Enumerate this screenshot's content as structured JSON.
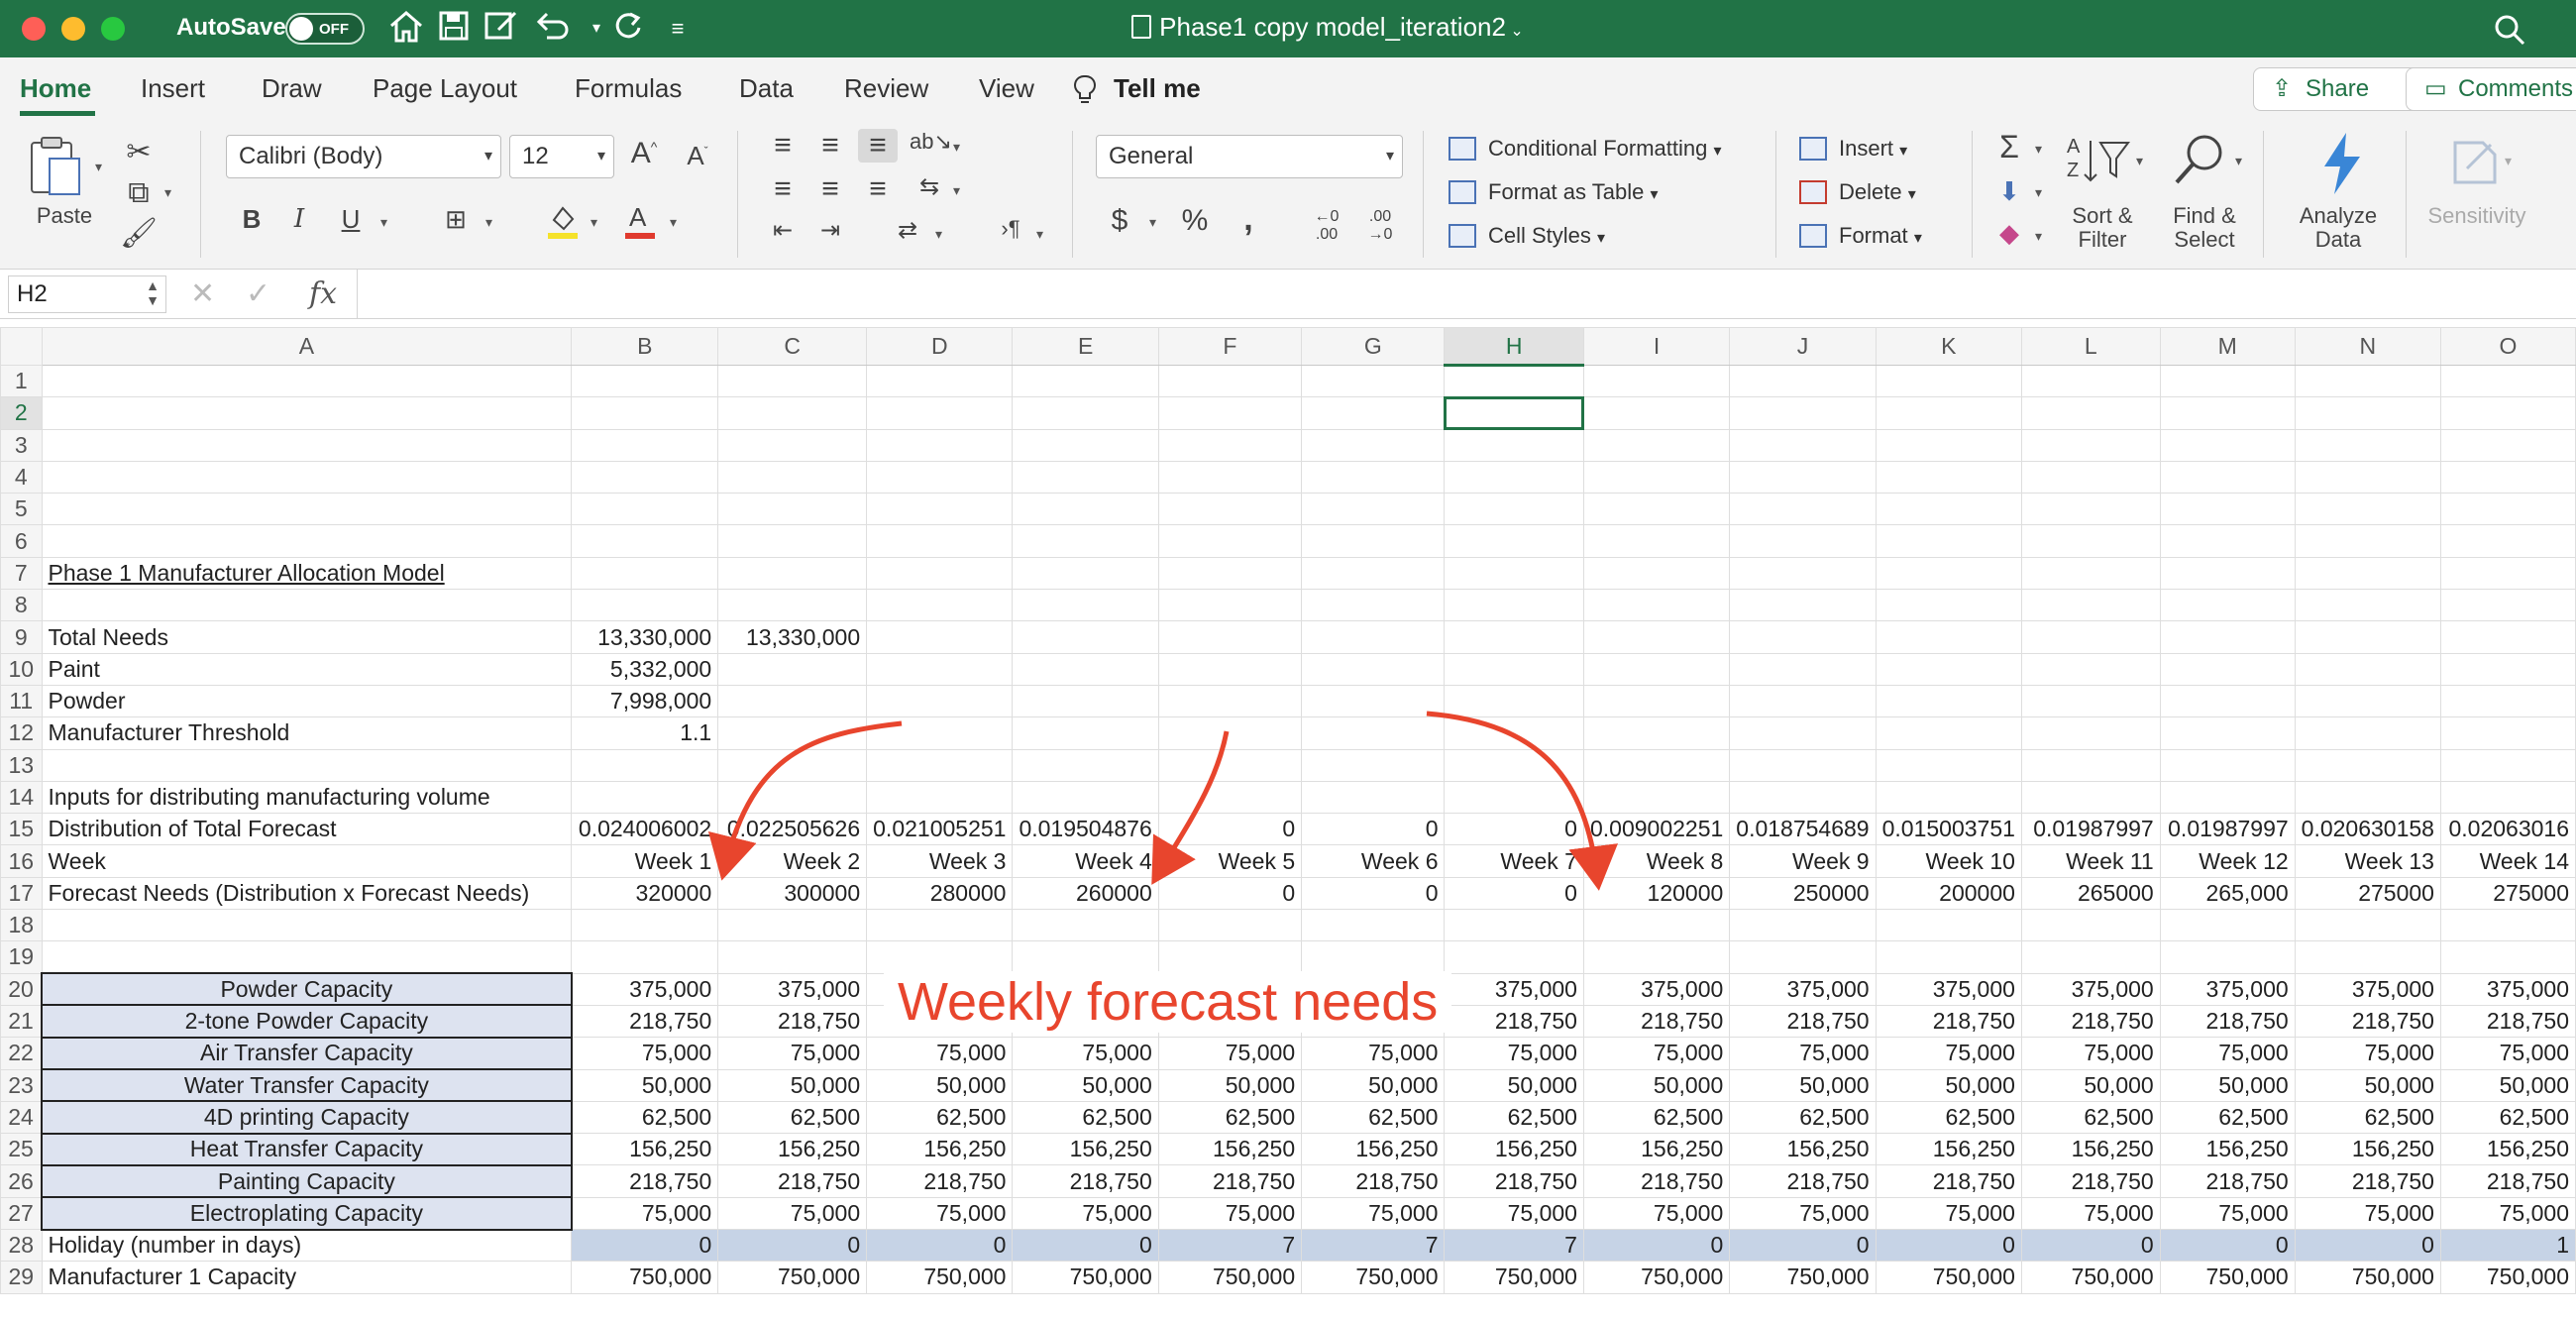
{
  "titlebar": {
    "autosave_label": "AutoSave",
    "autosave_state": "OFF",
    "document_title": "Phase1 copy model_iteration2",
    "accent": "#217346"
  },
  "tabs": [
    {
      "label": "Home"
    },
    {
      "label": "Insert"
    },
    {
      "label": "Draw"
    },
    {
      "label": "Page Layout"
    },
    {
      "label": "Formulas"
    },
    {
      "label": "Data"
    },
    {
      "label": "Review"
    },
    {
      "label": "View"
    },
    {
      "label": "Tell me"
    }
  ],
  "share_label": "Share",
  "comments_label": "Comments",
  "ribbon": {
    "paste_label": "Paste",
    "font_name": "Calibri (Body)",
    "font_size": "12",
    "bold": "B",
    "italic": "I",
    "underline": "U",
    "number_format": "General",
    "conditional_formatting": "Conditional Formatting",
    "format_as_table": "Format as Table",
    "cell_styles": "Cell Styles",
    "insert": "Insert",
    "delete": "Delete",
    "format": "Format",
    "sort_filter": "Sort & Filter",
    "find_select": "Find & Select",
    "analyze_data": "Analyze Data",
    "sensitivity": "Sensitivity",
    "currency": "$",
    "percent": "%",
    "comma": ",",
    "inc_decimal": "←0 .00",
    "dec_decimal": ".00 →0"
  },
  "formula_bar": {
    "name_box": "H2",
    "fx": "fx",
    "content": ""
  },
  "columns": [
    "A",
    "B",
    "C",
    "D",
    "E",
    "F",
    "G",
    "H",
    "I",
    "J",
    "K",
    "L",
    "M",
    "N",
    "O"
  ],
  "selected_column": "H",
  "selected_row": 2,
  "cells": {
    "r7": "Phase 1 Manufacturer Allocation Model",
    "r9": {
      "label": "Total Needs",
      "b": "13,330,000",
      "c": "13,330,000"
    },
    "r10": {
      "label": "Paint",
      "b": "5,332,000"
    },
    "r11": {
      "label": "Powder",
      "b": "7,998,000"
    },
    "r12": {
      "label": "Manufacturer Threshold",
      "b": "1.1"
    },
    "r14": "Inputs for distributing manufacturing volume",
    "r15": {
      "label": "Distribution of Total Forecast",
      "values": [
        "0.024006002",
        "0.022505626",
        "0.021005251",
        "0.019504876",
        "0",
        "0",
        "0",
        "0.009002251",
        "0.018754689",
        "0.015003751",
        "0.01987997",
        "0.01987997",
        "0.020630158",
        "0.02063016"
      ]
    },
    "r16": {
      "label": "Week",
      "values": [
        "Week 1",
        "Week 2",
        "Week 3",
        "Week 4",
        "Week 5",
        "Week 6",
        "Week 7",
        "Week 8",
        "Week 9",
        "Week 10",
        "Week 11",
        "Week 12",
        "Week 13",
        "Week 14"
      ]
    },
    "r17": {
      "label": "Forecast Needs (Distribution x Forecast Needs)",
      "values": [
        "320000",
        "300000",
        "280000",
        "260000",
        "0",
        "0",
        "0",
        "120000",
        "250000",
        "200000",
        "265000",
        "265,000",
        "275000",
        "275000"
      ]
    },
    "capacities": [
      {
        "row": 20,
        "label": "Powder Capacity",
        "value": "375,000"
      },
      {
        "row": 21,
        "label": "2-tone Powder Capacity",
        "value": "218,750"
      },
      {
        "row": 22,
        "label": "Air Transfer Capacity",
        "value": "75,000"
      },
      {
        "row": 23,
        "label": "Water Transfer Capacity",
        "value": "50,000"
      },
      {
        "row": 24,
        "label": "4D printing Capacity",
        "value": "62,500"
      },
      {
        "row": 25,
        "label": "Heat Transfer Capacity",
        "value": "156,250"
      },
      {
        "row": 26,
        "label": "Painting Capacity",
        "value": "218,750"
      },
      {
        "row": 27,
        "label": "Electroplating Capacity",
        "value": "75,000"
      }
    ],
    "r28": {
      "label": "Holiday (number in days)",
      "values": [
        "0",
        "0",
        "0",
        "0",
        "7",
        "7",
        "7",
        "0",
        "0",
        "0",
        "0",
        "0",
        "0",
        "1"
      ]
    },
    "r29": {
      "label": "Manufacturer 1 Capacity",
      "values": [
        "750,000",
        "750,000",
        "750,000",
        "750,000",
        "750,000",
        "750,000",
        "750,000",
        "750,000",
        "750,000",
        "750,000",
        "750,000",
        "750,000",
        "750,000",
        "750,000"
      ]
    }
  },
  "annotation": {
    "text": "Weekly forecast needs",
    "color": "#e8452d"
  }
}
